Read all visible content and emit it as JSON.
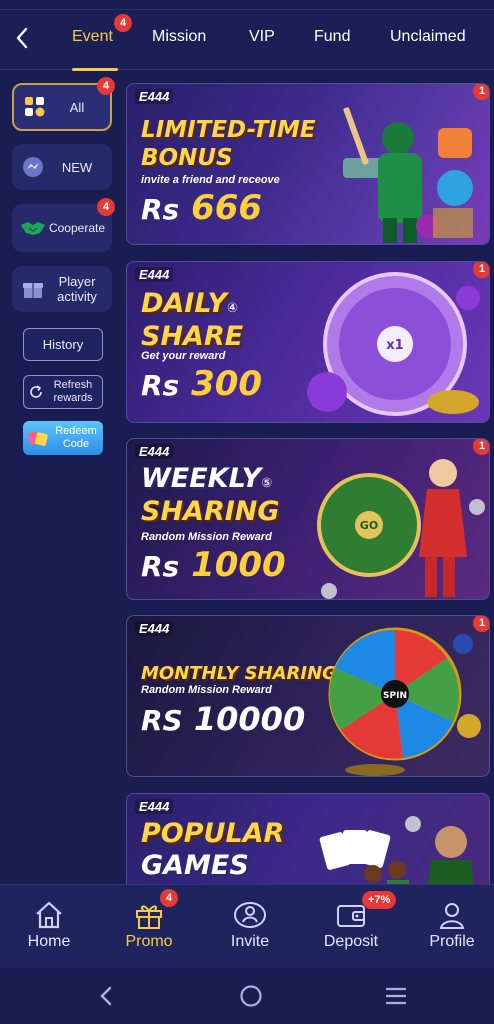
{
  "topbar": {
    "tabs": [
      {
        "label": "Event",
        "badge": "4",
        "active": true
      },
      {
        "label": "Mission"
      },
      {
        "label": "VIP"
      },
      {
        "label": "Fund"
      },
      {
        "label": "Unclaimed"
      }
    ]
  },
  "sidebar": {
    "items": [
      {
        "label": "All",
        "badge": "4",
        "active": true,
        "icon": "grid-icon"
      },
      {
        "label": "NEW",
        "icon": "messenger-icon"
      },
      {
        "label": "Cooperate",
        "badge": "4",
        "icon": "handshake-icon"
      },
      {
        "label": "Player activity",
        "icon": "gift-box-icon"
      }
    ],
    "history_label": "History",
    "refresh_label": "Refresh rewards",
    "redeem_label": "Redeem Code"
  },
  "banners": [
    {
      "brand": "E444",
      "title_l1": "LIMITED-TIME",
      "title_l2": "BONUS",
      "sub": "invite a friend and receove",
      "amount_prefix": "Rs",
      "amount": "666",
      "badge": "1"
    },
    {
      "brand": "E444",
      "title_l1": "DAILY",
      "title_l2": "SHARE",
      "title_sup": "④",
      "sub": "Get your reward",
      "amount_prefix": "Rs",
      "amount": "300",
      "badge": "1"
    },
    {
      "brand": "E444",
      "title_l1": "WEEKLY",
      "title_l2": "SHARING",
      "title_sup": "⑤",
      "sub": "Random Mission Reward",
      "amount_prefix": "Rs",
      "amount": "1000",
      "badge": "1"
    },
    {
      "brand": "E444",
      "title_l1": "MONTHLY SHARING",
      "sub": "Random Mission Reward",
      "amount_prefix": "RS",
      "amount": "10000",
      "badge": "1"
    },
    {
      "brand": "E444",
      "title_l1": "POPULAR",
      "title_l2": "GAMES"
    }
  ],
  "bottom_nav": {
    "items": [
      {
        "label": "Home",
        "icon": "home-icon"
      },
      {
        "label": "Promo",
        "icon": "gift-icon",
        "badge": "4",
        "active": true
      },
      {
        "label": "Invite",
        "icon": "invite-people-icon"
      },
      {
        "label": "Deposit",
        "icon": "wallet-icon",
        "badge": "+7%"
      },
      {
        "label": "Profile",
        "icon": "profile-icon"
      }
    ]
  },
  "colors": {
    "background": "#1a1d52",
    "accent_gold": "#f7c948",
    "badge_red": "#e53935"
  }
}
